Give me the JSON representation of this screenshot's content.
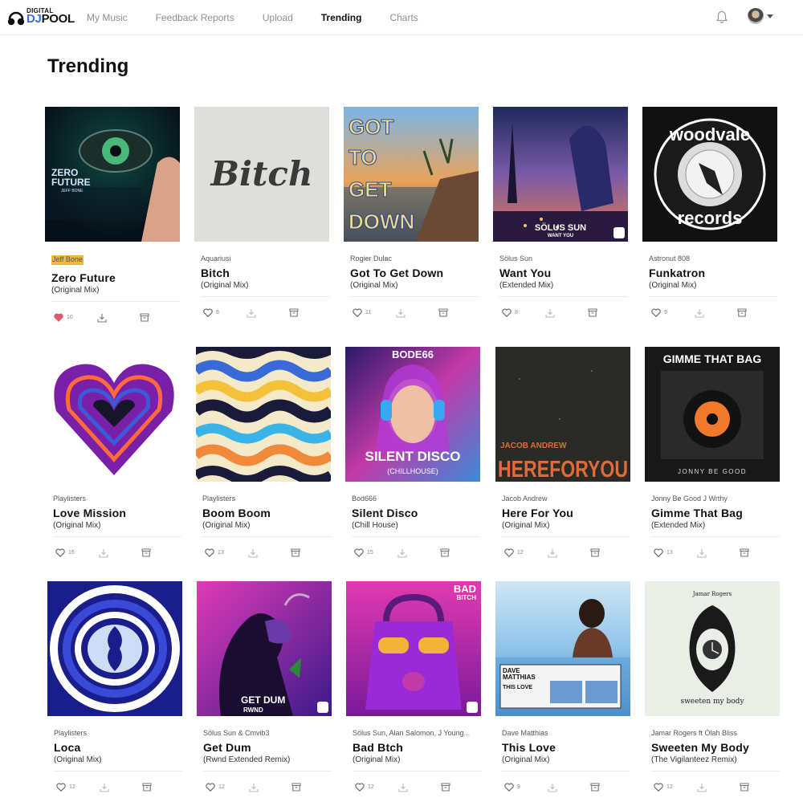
{
  "brand": {
    "small": "DIGITAL",
    "dj": "DJ",
    "pool": "POOL"
  },
  "nav": [
    "My Music",
    "Feedback Reports",
    "Upload",
    "Trending",
    "Charts"
  ],
  "active_nav": "Trending",
  "page_title": "Trending",
  "icons": {
    "bell": "bell-icon",
    "heart": "heart-icon",
    "download": "download-icon",
    "crate": "crate-icon",
    "avatar": "avatar",
    "caret": "chevron-down-icon"
  },
  "colors": {
    "accent": "#3b6fe0",
    "highlight": "#f1b73f",
    "liked": "#e05a6d"
  },
  "tracks": [
    {
      "artist": "Jeff Bone",
      "title": "Zero Future",
      "mix": "(Original Mix)",
      "likes": "10",
      "liked": true,
      "cover_text": [
        "ZERO",
        "FUTURE",
        "JEFF BONE"
      ]
    },
    {
      "artist": "Aquariusi",
      "title": "Bitch",
      "mix": "(Original Mix)",
      "likes": "8",
      "liked": false,
      "cover_text": [
        "Bitch"
      ]
    },
    {
      "artist": "Rogier Dulac",
      "title": "Got To Get Down",
      "mix": "(Original Mix)",
      "likes": "11",
      "liked": false,
      "cover_text": [
        "GOT",
        "TO",
        "GET",
        "DOWN"
      ]
    },
    {
      "artist": "Sölus Sun",
      "title": "Want You",
      "mix": "(Extended Mix)",
      "likes": "8",
      "liked": false,
      "cover_text": [
        "SÖLUS SUN",
        "WANT YOU"
      ]
    },
    {
      "artist": "Astronut 808",
      "title": "Funkatron",
      "mix": "(Original Mix)",
      "likes": "9",
      "liked": false,
      "cover_text": [
        "woodvale",
        "records"
      ]
    },
    {
      "artist": "Playlisters",
      "title": "Love Mission",
      "mix": "(Original Mix)",
      "likes": "16",
      "liked": false,
      "cover_text": []
    },
    {
      "artist": "Playlisters",
      "title": "Boom Boom",
      "mix": "(Original Mix)",
      "likes": "13",
      "liked": false,
      "cover_text": []
    },
    {
      "artist": "Bod666",
      "title": "Silent Disco",
      "mix": "(Chill House)",
      "likes": "15",
      "liked": false,
      "cover_text": [
        "BODE66",
        "SILENT DISCO",
        "(CHILLHOUSE)"
      ]
    },
    {
      "artist": "Jacob Andrew",
      "title": "Here For You",
      "mix": "(Original Mix)",
      "likes": "12",
      "liked": false,
      "cover_text": [
        "JACOB ANDREW",
        "HEREFORYOU"
      ]
    },
    {
      "artist": "Jonny Be Good J Wrthy",
      "title": "Gimme That Bag",
      "mix": "(Extended Mix)",
      "likes": "13",
      "liked": false,
      "cover_text": [
        "GIMME THAT BAG",
        "JONNY BE GOOD"
      ]
    },
    {
      "artist": "Playlisters",
      "title": "Loca",
      "mix": "(Original Mix)",
      "likes": "12",
      "liked": false,
      "cover_text": []
    },
    {
      "artist": "Sölus Sun & Cmvib3",
      "title": "Get Dum",
      "mix": "(Rwnd Extended Remix)",
      "likes": "12",
      "liked": false,
      "cover_text": [
        "GET DUM",
        "RWND"
      ]
    },
    {
      "artist": "Sölus Sun, Alan Salomon, J Young...",
      "title": "Bad Btch",
      "mix": "(Original Mix)",
      "likes": "12",
      "liked": false,
      "cover_text": [
        "BAD",
        "BITCH"
      ]
    },
    {
      "artist": "Dave Matthias",
      "title": "This Love",
      "mix": "(Original Mix)",
      "likes": "9",
      "liked": false,
      "cover_text": [
        "DAVE",
        "MATTHIAS",
        "THIS LOVE"
      ]
    },
    {
      "artist": "Jamar Rogers ft Ólah Bliss",
      "title": "Sweeten My Body",
      "mix": "(The Vigilanteez Remix)",
      "likes": "12",
      "liked": false,
      "cover_text": [
        "Jamar Rogers",
        "sweeten my body"
      ]
    }
  ]
}
